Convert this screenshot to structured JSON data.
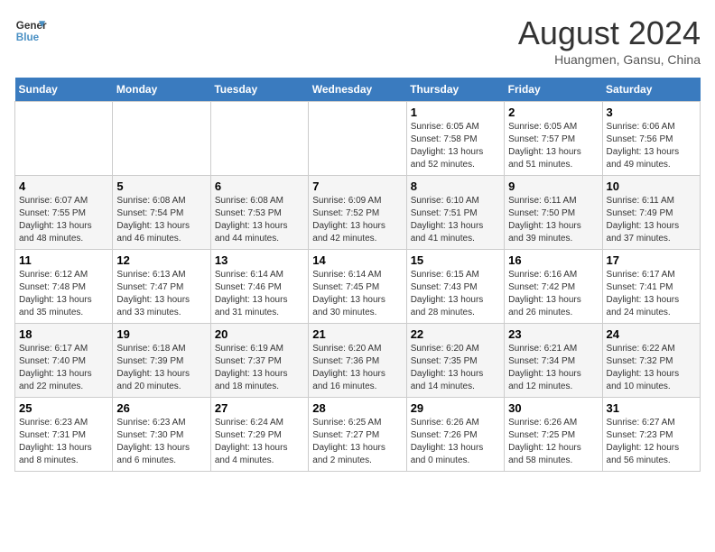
{
  "header": {
    "logo_line1": "General",
    "logo_line2": "Blue",
    "month": "August 2024",
    "location": "Huangmen, Gansu, China"
  },
  "weekdays": [
    "Sunday",
    "Monday",
    "Tuesday",
    "Wednesday",
    "Thursday",
    "Friday",
    "Saturday"
  ],
  "weeks": [
    [
      {
        "day": "",
        "info": ""
      },
      {
        "day": "",
        "info": ""
      },
      {
        "day": "",
        "info": ""
      },
      {
        "day": "",
        "info": ""
      },
      {
        "day": "1",
        "info": "Sunrise: 6:05 AM\nSunset: 7:58 PM\nDaylight: 13 hours\nand 52 minutes."
      },
      {
        "day": "2",
        "info": "Sunrise: 6:05 AM\nSunset: 7:57 PM\nDaylight: 13 hours\nand 51 minutes."
      },
      {
        "day": "3",
        "info": "Sunrise: 6:06 AM\nSunset: 7:56 PM\nDaylight: 13 hours\nand 49 minutes."
      }
    ],
    [
      {
        "day": "4",
        "info": "Sunrise: 6:07 AM\nSunset: 7:55 PM\nDaylight: 13 hours\nand 48 minutes."
      },
      {
        "day": "5",
        "info": "Sunrise: 6:08 AM\nSunset: 7:54 PM\nDaylight: 13 hours\nand 46 minutes."
      },
      {
        "day": "6",
        "info": "Sunrise: 6:08 AM\nSunset: 7:53 PM\nDaylight: 13 hours\nand 44 minutes."
      },
      {
        "day": "7",
        "info": "Sunrise: 6:09 AM\nSunset: 7:52 PM\nDaylight: 13 hours\nand 42 minutes."
      },
      {
        "day": "8",
        "info": "Sunrise: 6:10 AM\nSunset: 7:51 PM\nDaylight: 13 hours\nand 41 minutes."
      },
      {
        "day": "9",
        "info": "Sunrise: 6:11 AM\nSunset: 7:50 PM\nDaylight: 13 hours\nand 39 minutes."
      },
      {
        "day": "10",
        "info": "Sunrise: 6:11 AM\nSunset: 7:49 PM\nDaylight: 13 hours\nand 37 minutes."
      }
    ],
    [
      {
        "day": "11",
        "info": "Sunrise: 6:12 AM\nSunset: 7:48 PM\nDaylight: 13 hours\nand 35 minutes."
      },
      {
        "day": "12",
        "info": "Sunrise: 6:13 AM\nSunset: 7:47 PM\nDaylight: 13 hours\nand 33 minutes."
      },
      {
        "day": "13",
        "info": "Sunrise: 6:14 AM\nSunset: 7:46 PM\nDaylight: 13 hours\nand 31 minutes."
      },
      {
        "day": "14",
        "info": "Sunrise: 6:14 AM\nSunset: 7:45 PM\nDaylight: 13 hours\nand 30 minutes."
      },
      {
        "day": "15",
        "info": "Sunrise: 6:15 AM\nSunset: 7:43 PM\nDaylight: 13 hours\nand 28 minutes."
      },
      {
        "day": "16",
        "info": "Sunrise: 6:16 AM\nSunset: 7:42 PM\nDaylight: 13 hours\nand 26 minutes."
      },
      {
        "day": "17",
        "info": "Sunrise: 6:17 AM\nSunset: 7:41 PM\nDaylight: 13 hours\nand 24 minutes."
      }
    ],
    [
      {
        "day": "18",
        "info": "Sunrise: 6:17 AM\nSunset: 7:40 PM\nDaylight: 13 hours\nand 22 minutes."
      },
      {
        "day": "19",
        "info": "Sunrise: 6:18 AM\nSunset: 7:39 PM\nDaylight: 13 hours\nand 20 minutes."
      },
      {
        "day": "20",
        "info": "Sunrise: 6:19 AM\nSunset: 7:37 PM\nDaylight: 13 hours\nand 18 minutes."
      },
      {
        "day": "21",
        "info": "Sunrise: 6:20 AM\nSunset: 7:36 PM\nDaylight: 13 hours\nand 16 minutes."
      },
      {
        "day": "22",
        "info": "Sunrise: 6:20 AM\nSunset: 7:35 PM\nDaylight: 13 hours\nand 14 minutes."
      },
      {
        "day": "23",
        "info": "Sunrise: 6:21 AM\nSunset: 7:34 PM\nDaylight: 13 hours\nand 12 minutes."
      },
      {
        "day": "24",
        "info": "Sunrise: 6:22 AM\nSunset: 7:32 PM\nDaylight: 13 hours\nand 10 minutes."
      }
    ],
    [
      {
        "day": "25",
        "info": "Sunrise: 6:23 AM\nSunset: 7:31 PM\nDaylight: 13 hours\nand 8 minutes."
      },
      {
        "day": "26",
        "info": "Sunrise: 6:23 AM\nSunset: 7:30 PM\nDaylight: 13 hours\nand 6 minutes."
      },
      {
        "day": "27",
        "info": "Sunrise: 6:24 AM\nSunset: 7:29 PM\nDaylight: 13 hours\nand 4 minutes."
      },
      {
        "day": "28",
        "info": "Sunrise: 6:25 AM\nSunset: 7:27 PM\nDaylight: 13 hours\nand 2 minutes."
      },
      {
        "day": "29",
        "info": "Sunrise: 6:26 AM\nSunset: 7:26 PM\nDaylight: 13 hours\nand 0 minutes."
      },
      {
        "day": "30",
        "info": "Sunrise: 6:26 AM\nSunset: 7:25 PM\nDaylight: 12 hours\nand 58 minutes."
      },
      {
        "day": "31",
        "info": "Sunrise: 6:27 AM\nSunset: 7:23 PM\nDaylight: 12 hours\nand 56 minutes."
      }
    ]
  ]
}
